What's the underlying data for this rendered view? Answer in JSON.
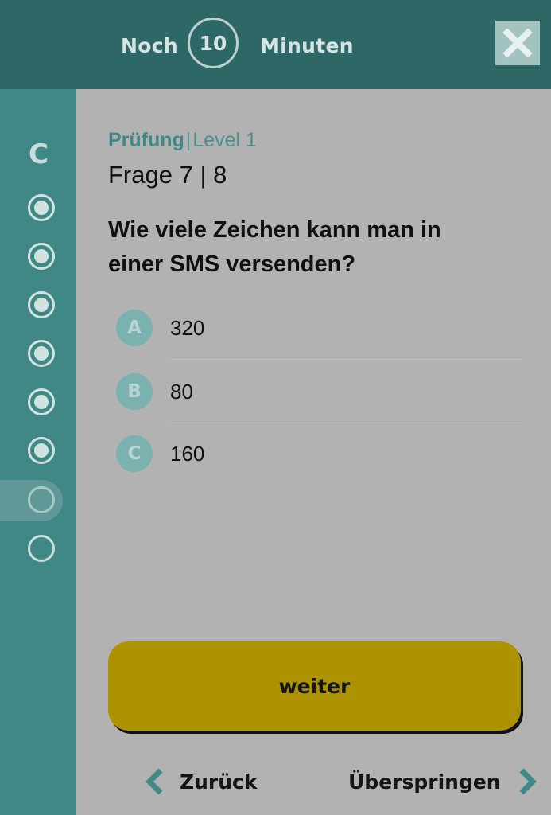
{
  "header": {
    "timer_prefix": "Noch",
    "timer_value": "10",
    "timer_suffix": "Minuten",
    "close_icon": "close-icon"
  },
  "sidebar": {
    "section_letter": "C",
    "question_dots": 8,
    "answered": 6,
    "current_index": 7
  },
  "exam": {
    "title": "Prüfung",
    "separator": "|",
    "level": "Level 1",
    "question_label": "Frage 7 | 8",
    "question_text": "Wie viele Zeichen kann man in einer SMS versenden?"
  },
  "answers": [
    {
      "letter": "A",
      "text": "320"
    },
    {
      "letter": "B",
      "text": "80"
    },
    {
      "letter": "C",
      "text": "160"
    }
  ],
  "actions": {
    "next_label": "weiter",
    "back_label": "Zurück",
    "skip_label": "Überspringen"
  },
  "colors": {
    "header": "#2e6866",
    "sidebar": "#3f8885",
    "accent": "#3f8a86",
    "next_button": "#ad9300",
    "overlay_bg": "#b2b2b2"
  }
}
